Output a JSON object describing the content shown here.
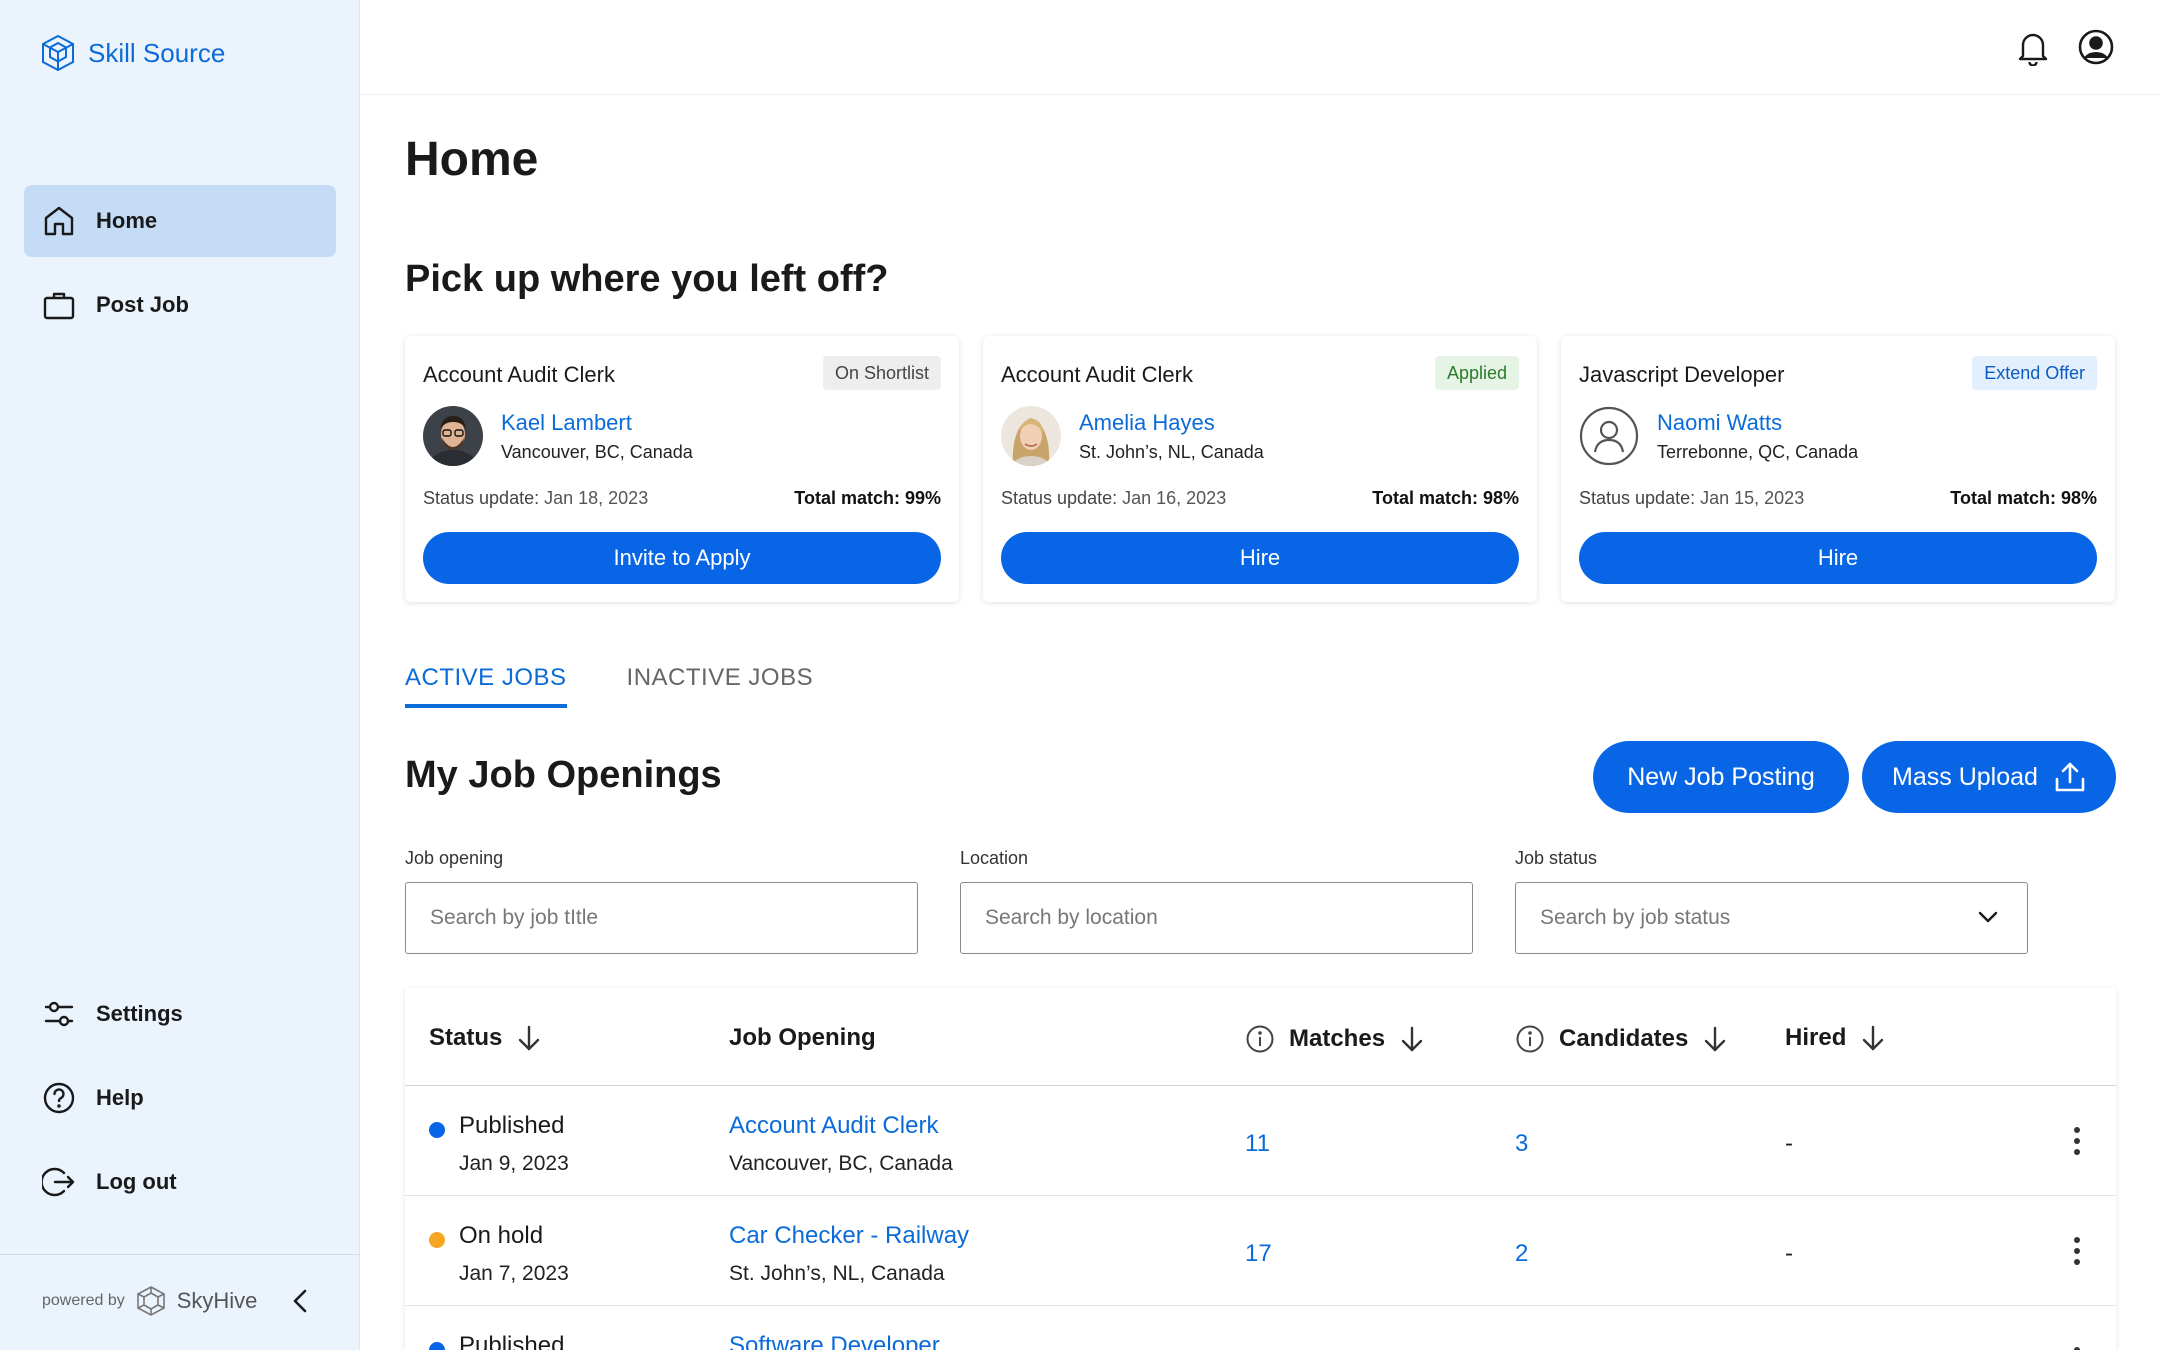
{
  "brand": {
    "name": "Skill Source",
    "powered_by": "powered by",
    "vendor": "SkyHive"
  },
  "sidebar": {
    "top_items": [
      {
        "label": "Home",
        "icon": "home-icon",
        "active": true
      },
      {
        "label": "Post Job",
        "icon": "briefcase-icon",
        "active": false
      }
    ],
    "bottom_items": [
      {
        "label": "Settings",
        "icon": "sliders-icon"
      },
      {
        "label": "Help",
        "icon": "help-circle-icon"
      },
      {
        "label": "Log out",
        "icon": "logout-icon"
      }
    ]
  },
  "page": {
    "title": "Home",
    "resume_title": "Pick up where you left off?"
  },
  "cards": [
    {
      "job": "Account Audit Clerk",
      "badge": "On Shortlist",
      "name": "Kael Lambert",
      "location": "Vancouver, BC, Canada",
      "status_label": "Status update:",
      "status_date": "Jan 18, 2023",
      "match": "Total match: 99%",
      "action": "Invite to Apply"
    },
    {
      "job": "Account Audit Clerk",
      "badge": "Applied",
      "name": "Amelia Hayes",
      "location": "St. John’s, NL, Canada",
      "status_label": "Status update:",
      "status_date": "Jan 16, 2023",
      "match": "Total match: 98%",
      "action": "Hire"
    },
    {
      "job": "Javascript Developer",
      "badge": "Extend Offer",
      "name": "Naomi Watts",
      "location": "Terrebonne, QC, Canada",
      "status_label": "Status update:",
      "status_date": "Jan 15, 2023",
      "match": "Total match: 98%",
      "action": "Hire"
    }
  ],
  "tabs": [
    {
      "label": "ACTIVE JOBS",
      "active": true
    },
    {
      "label": "INACTIVE JOBS",
      "active": false
    }
  ],
  "openings": {
    "title": "My Job Openings",
    "new_button": "New Job Posting",
    "upload_button": "Mass Upload"
  },
  "filters": {
    "job": {
      "label": "Job opening",
      "placeholder": "Search by job tItle"
    },
    "location": {
      "label": "Location",
      "placeholder": "Search by location"
    },
    "status": {
      "label": "Job status",
      "placeholder": "Search by job status"
    }
  },
  "table": {
    "headers": {
      "status": "Status",
      "job": "Job Opening",
      "matches": "Matches",
      "candidates": "Candidates",
      "hired": "Hired"
    },
    "rows": [
      {
        "status": "Published",
        "status_color": "#0866e6",
        "date": "Jan 9, 2023",
        "job": "Account Audit Clerk",
        "location": "Vancouver, BC, Canada",
        "matches": "11",
        "candidates": "3",
        "hired": "-"
      },
      {
        "status": "On hold",
        "status_color": "#f5a623",
        "date": "Jan 7, 2023",
        "job": "Car Checker - Railway",
        "location": "St. John’s, NL, Canada",
        "matches": "17",
        "candidates": "2",
        "hired": "-"
      },
      {
        "status": "Published",
        "status_color": "#0866e6",
        "date": "",
        "job": "Software Developer",
        "location": "",
        "matches": "",
        "candidates": "",
        "hired": ""
      }
    ]
  },
  "colors": {
    "accent": "#0866e6",
    "link": "#0b6bd8",
    "sidebar_bg": "#ebf3fd",
    "active_nav": "#c5dcf6"
  }
}
